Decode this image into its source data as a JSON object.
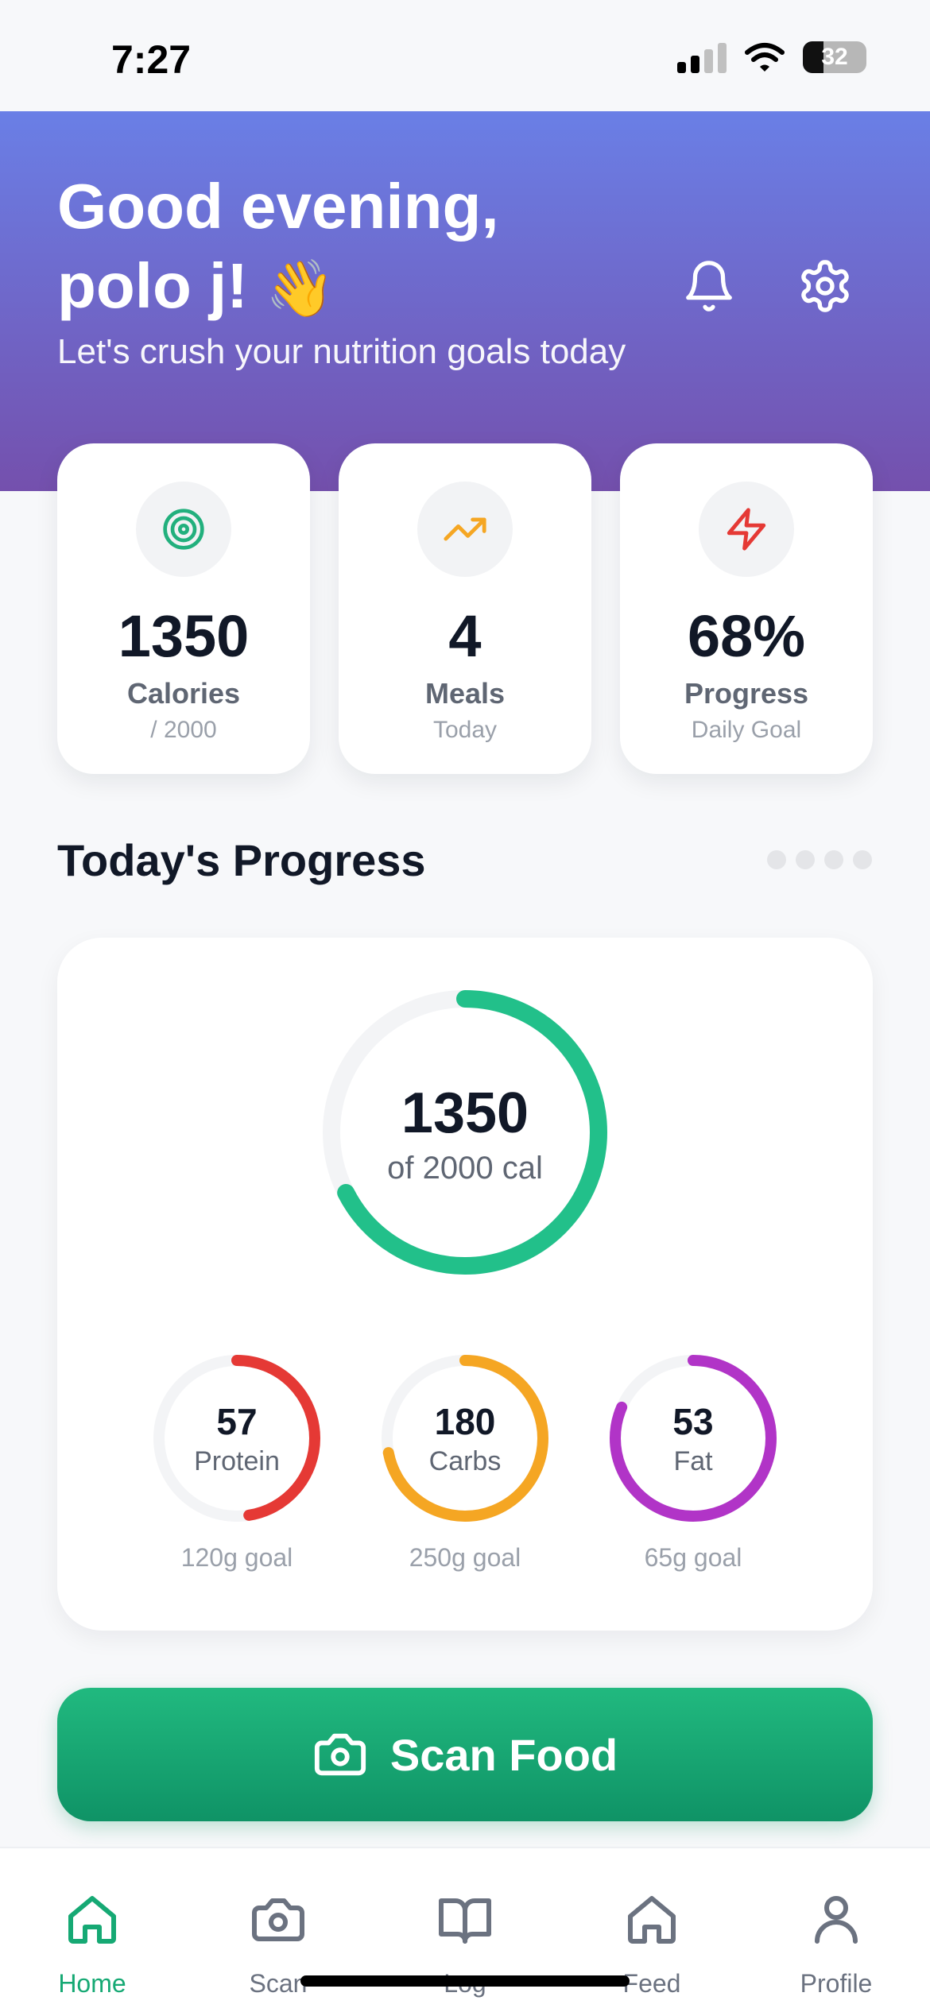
{
  "status_bar": {
    "time": "7:27",
    "battery": "32"
  },
  "header": {
    "greeting_line1": "Good evening,",
    "greeting_line2": "polo j!",
    "wave_emoji": "👋",
    "subtitle": "Let's crush your nutrition goals today"
  },
  "stats": [
    {
      "icon": "target-icon",
      "value": "1350",
      "label": "Calories",
      "sub": "/ 2000"
    },
    {
      "icon": "trending-up-icon",
      "value": "4",
      "label": "Meals",
      "sub": "Today"
    },
    {
      "icon": "lightning-icon",
      "value": "68%",
      "label": "Progress",
      "sub": "Daily Goal"
    }
  ],
  "progress": {
    "title": "Today's Progress",
    "calories": {
      "value": "1350",
      "sub": "of 2000 cal",
      "fraction": 0.675
    },
    "macros": [
      {
        "value": "57",
        "label": "Protein",
        "goal": "120g goal",
        "fraction": 0.475,
        "color": "#e53935"
      },
      {
        "value": "180",
        "label": "Carbs",
        "goal": "250g goal",
        "fraction": 0.72,
        "color": "#f5a623"
      },
      {
        "value": "53",
        "label": "Fat",
        "goal": "65g goal",
        "fraction": 0.815,
        "color": "#b134c7"
      }
    ]
  },
  "scan_button": {
    "label": "Scan Food"
  },
  "nav": [
    {
      "label": "Home",
      "icon": "home-icon",
      "active": true
    },
    {
      "label": "Scan",
      "icon": "camera-icon",
      "active": false
    },
    {
      "label": "Log",
      "icon": "book-icon",
      "active": false
    },
    {
      "label": "Feed",
      "icon": "feed-icon",
      "active": false
    },
    {
      "label": "Profile",
      "icon": "user-icon",
      "active": false
    }
  ],
  "colors": {
    "accent_green": "#22c08a",
    "header_top": "#6a7fe6",
    "header_bottom": "#7450ad"
  }
}
